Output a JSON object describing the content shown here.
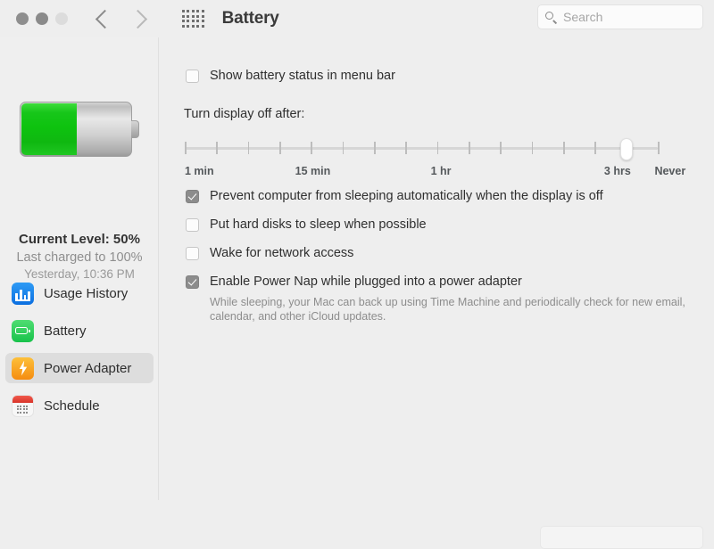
{
  "window": {
    "title": "Battery",
    "traffic_lights": [
      "close",
      "minimize",
      "maximize"
    ]
  },
  "toolbar": {
    "back_label": "Back",
    "forward_label": "Forward",
    "grid_label": "Show All",
    "title": "Battery",
    "search": {
      "placeholder": "Search",
      "value": ""
    }
  },
  "sidebar": {
    "battery_percent": 50,
    "status": {
      "current_level": "Current Level: 50%",
      "last_charged": "Last charged to 100%",
      "charge_time": "Yesterday, 10:36 PM"
    },
    "items": [
      {
        "label": "Usage History",
        "icon": "bar-chart-icon",
        "selected": false
      },
      {
        "label": "Battery",
        "icon": "battery-icon",
        "selected": false
      },
      {
        "label": "Power Adapter",
        "icon": "bolt-icon",
        "selected": true
      },
      {
        "label": "Schedule",
        "icon": "calendar-icon",
        "selected": false
      }
    ]
  },
  "main": {
    "show_battery_status": {
      "label": "Show battery status in menu bar",
      "checked": false
    },
    "display_sleep": {
      "title": "Turn display off after:",
      "value": "3 hrs",
      "tick_count": 16,
      "knob_tick_index": 14,
      "labels": [
        {
          "text": "1 min",
          "tick": 0
        },
        {
          "text": "15 min",
          "tick": 3.5
        },
        {
          "text": "1 hr",
          "tick": 7.8
        },
        {
          "text": "3 hrs",
          "tick": 13.3
        },
        {
          "text": "Never",
          "tick": 14.9
        }
      ]
    },
    "options": [
      {
        "label": "Prevent computer from sleeping automatically when the display is off",
        "checked": true
      },
      {
        "label": "Put hard disks to sleep when possible",
        "checked": false
      },
      {
        "label": "Wake for network access",
        "checked": false
      },
      {
        "label": "Enable Power Nap while plugged into a power adapter",
        "checked": true
      }
    ],
    "power_nap_help": "While sleeping, your Mac can back up using Time Machine and periodically check for new email, calendar, and other iCloud updates."
  },
  "colors": {
    "window_bg": "#eeeeee",
    "sidebar_bg": "#efefef",
    "battery_green": "#18c61a",
    "accent_blue": "#1a82e8",
    "accent_orange": "#f7a01b",
    "accent_red": "#e03a2c",
    "checkbox_checked": "#8c8c8c"
  }
}
